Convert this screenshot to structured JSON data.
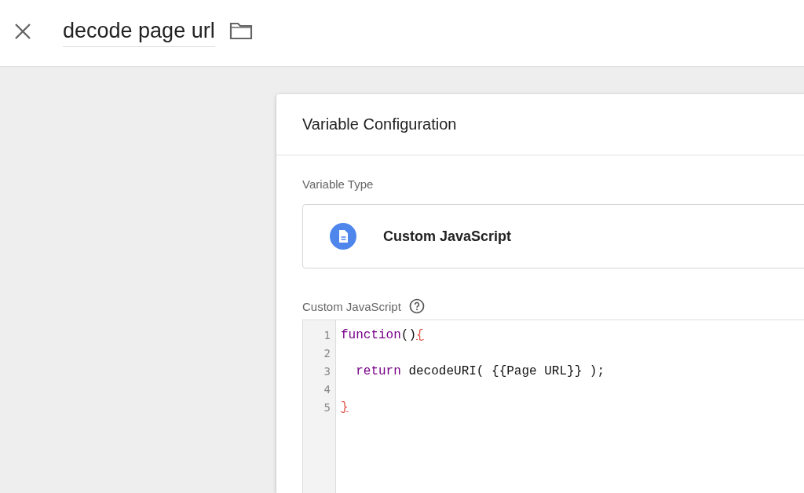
{
  "header": {
    "title": "decode page url"
  },
  "panel": {
    "title": "Variable Configuration",
    "type_label": "Variable Type",
    "type_name": "Custom JavaScript",
    "code_label": "Custom JavaScript",
    "code_lines": [
      {
        "number": "1",
        "tokens": [
          {
            "kind": "keyword",
            "text": "function"
          },
          {
            "kind": "plain",
            "text": "()"
          },
          {
            "kind": "bracket",
            "text": "{"
          }
        ]
      },
      {
        "number": "2"
      },
      {
        "number": "3",
        "tokens": [
          {
            "kind": "keyword",
            "text": "  return"
          },
          {
            "kind": "plain",
            "text": " decodeURI( {{Page URL}} );"
          }
        ]
      },
      {
        "number": "4"
      },
      {
        "number": "5",
        "tokens": [
          {
            "kind": "bracket",
            "text": "}"
          }
        ]
      }
    ]
  }
}
